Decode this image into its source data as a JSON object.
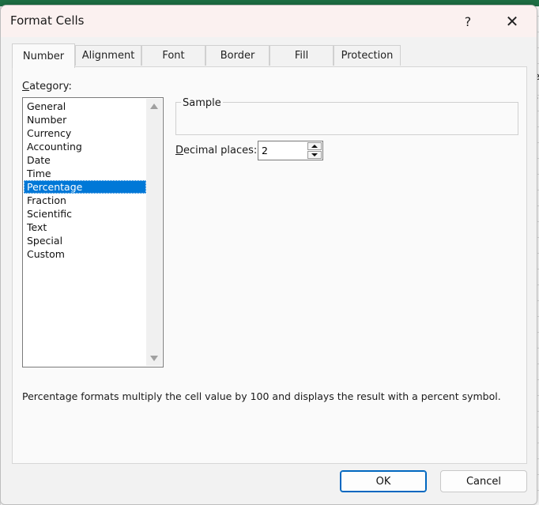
{
  "dialog": {
    "title": "Format Cells",
    "help_glyph": "?",
    "close_glyph": "✕"
  },
  "tabs": [
    {
      "label": "Number",
      "active": true
    },
    {
      "label": "Alignment",
      "active": false
    },
    {
      "label": "Font",
      "active": false
    },
    {
      "label": "Border",
      "active": false
    },
    {
      "label": "Fill",
      "active": false
    },
    {
      "label": "Protection",
      "active": false
    }
  ],
  "category": {
    "label_accel": "C",
    "label_rest": "ategory:",
    "items": [
      "General",
      "Number",
      "Currency",
      "Accounting",
      "Date",
      "Time",
      "Percentage",
      "Fraction",
      "Scientific",
      "Text",
      "Special",
      "Custom"
    ],
    "selected": "Percentage"
  },
  "sample": {
    "legend": "Sample",
    "value": ""
  },
  "decimal_places": {
    "label_accel": "D",
    "label_rest": "ecimal places:",
    "value": "2"
  },
  "description": "Percentage formats multiply the cell value by 100 and displays the result with a percent symbol.",
  "buttons": {
    "ok": "OK",
    "cancel": "Cancel"
  },
  "background_edge_letters": [
    "e",
    "r",
    "l"
  ],
  "colors": {
    "accent": "#0078d7",
    "excel_green": "#1e7145",
    "title_bar": "#fbf1f0"
  }
}
